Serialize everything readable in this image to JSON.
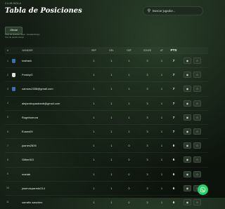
{
  "brand": "CLUB BOLA",
  "title": "Tabla de Posiciones",
  "search": {
    "placeholder": "Buscar jugador..."
  },
  "tabs": [
    {
      "label": "Oficial",
      "active": true
    }
  ],
  "filters": {
    "line1": "Filtro de posición      Selec. Jornada      Rango",
    "line2": "Tipo de partido      Grupo"
  },
  "table": {
    "headers": [
      "#",
      "JUGADOR",
      "REP",
      "GEL",
      "GEF",
      "GOLES",
      "AT",
      "PTS"
    ],
    "rows": [
      {
        "pos": "1",
        "name": "Iosfrank",
        "rep": "1",
        "gel": "1",
        "gef": "1",
        "goles": "3",
        "at": "1",
        "pts": "7",
        "logo": "#3b6fb6"
      },
      {
        "pos": "2",
        "name": "FreddyG",
        "rep": "1",
        "gel": "1",
        "gef": "1",
        "goles": "3",
        "at": "1",
        "pts": "7",
        "logo": "#e0e0e0"
      },
      {
        "pos": "3",
        "name": "camaru2338@gmail.com",
        "rep": "1",
        "gel": "1",
        "gef": "1",
        "goles": "3",
        "at": "1",
        "pts": "7",
        "logo": "#3b6fb6"
      },
      {
        "pos": "4",
        "name": "alejandropastranb@gmail.com",
        "rep": "1",
        "gel": "1",
        "gef": "1",
        "goles": "3",
        "at": "1",
        "pts": "7",
        "logo": ""
      },
      {
        "pos": "5",
        "name": "Rogeiromora",
        "rep": "1",
        "gel": "1",
        "gef": "1",
        "goles": "3",
        "at": "1",
        "pts": "7",
        "logo": ""
      },
      {
        "pos": "6",
        "name": "Euses09",
        "rep": "1",
        "gel": "1",
        "gef": "1",
        "goles": "3",
        "at": "1",
        "pts": "7",
        "logo": ""
      },
      {
        "pos": "7",
        "name": "joanes2826",
        "rep": "1",
        "gel": "1",
        "gef": "0",
        "goles": "3",
        "at": "1",
        "pts": "6",
        "logo": ""
      },
      {
        "pos": "8",
        "name": "Gilberti10",
        "rep": "1",
        "gel": "1",
        "gef": "0",
        "goles": "3",
        "at": "1",
        "pts": "6",
        "logo": ""
      },
      {
        "pos": "9",
        "name": "mariab",
        "rep": "1",
        "gel": "1",
        "gef": "0",
        "goles": "3",
        "at": "1",
        "pts": "6",
        "logo": ""
      },
      {
        "pos": "10",
        "name": "joseruizparedo214",
        "rep": "1",
        "gel": "1",
        "gef": "0",
        "goles": "3",
        "at": "1",
        "pts": "6",
        "logo": ""
      },
      {
        "pos": "11",
        "name": "carrafio sanchez",
        "rep": "1",
        "gel": "1",
        "gef": "0",
        "goles": "3",
        "at": "1",
        "pts": "6",
        "logo": ""
      }
    ]
  },
  "icons": {
    "search": "search-icon",
    "view": "eye-icon",
    "favorite": "star-icon",
    "chat": "whatsapp-icon"
  },
  "colors": {
    "accent": "#25d366",
    "background": "#0f170f"
  }
}
